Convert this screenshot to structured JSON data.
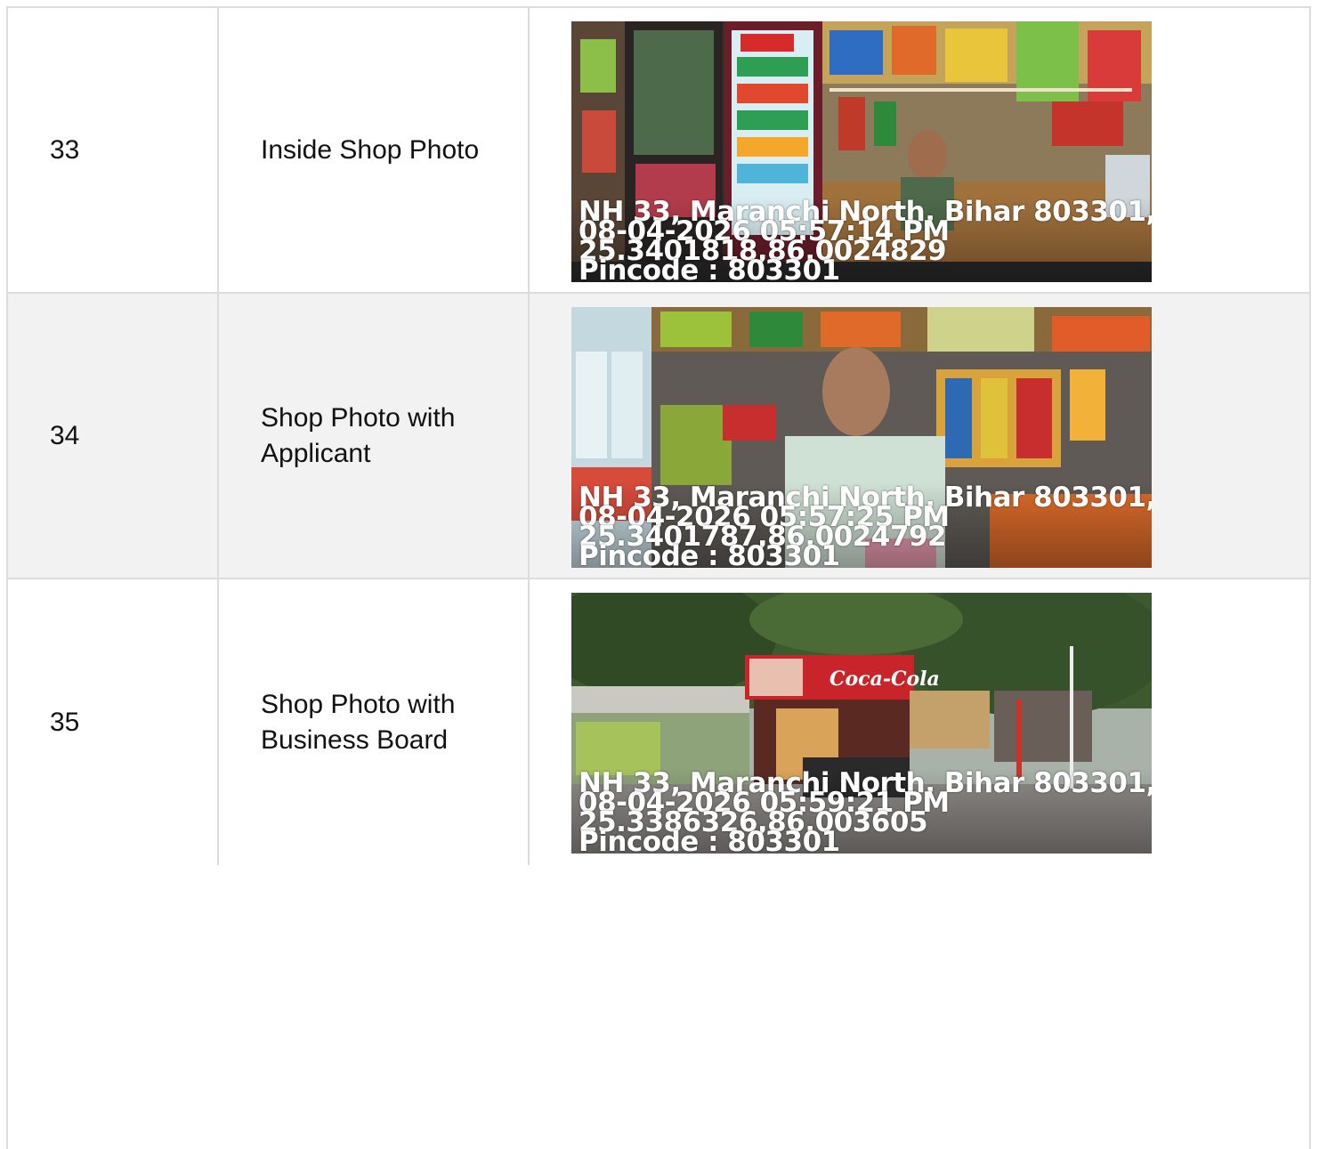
{
  "rows": [
    {
      "number": "33",
      "label": "Inside Shop Photo",
      "photo": {
        "subject": "shop-interior-shelves",
        "stamp": {
          "address": "NH 33, Maranchi North, Bihar 803301, ...",
          "datetime": "08-04-2026 05:57:14 PM",
          "coords": "25.3401818,86.0024829",
          "pincode": "Pincode : 803301"
        }
      }
    },
    {
      "number": "34",
      "label": "Shop Photo with Applicant",
      "photo": {
        "subject": "shopkeeper-at-counter",
        "stamp": {
          "address": "NH 33, Maranchi North, Bihar 803301, ...",
          "datetime": "08-04-2026 05:57:25 PM",
          "coords": "25.3401787,86.0024792",
          "pincode": "Pincode : 803301"
        }
      }
    },
    {
      "number": "35",
      "label": "Shop Photo with Business Board",
      "photo": {
        "subject": "shop-exterior-with-board",
        "board_text": "Coca-Cola",
        "stamp": {
          "address": "NH 33, Maranchi North, Bihar 803301, ...",
          "datetime": "08-04-2026 05:59:21 PM",
          "coords": "25.3386326,86.003605",
          "pincode": "Pincode : 803301"
        }
      }
    }
  ]
}
